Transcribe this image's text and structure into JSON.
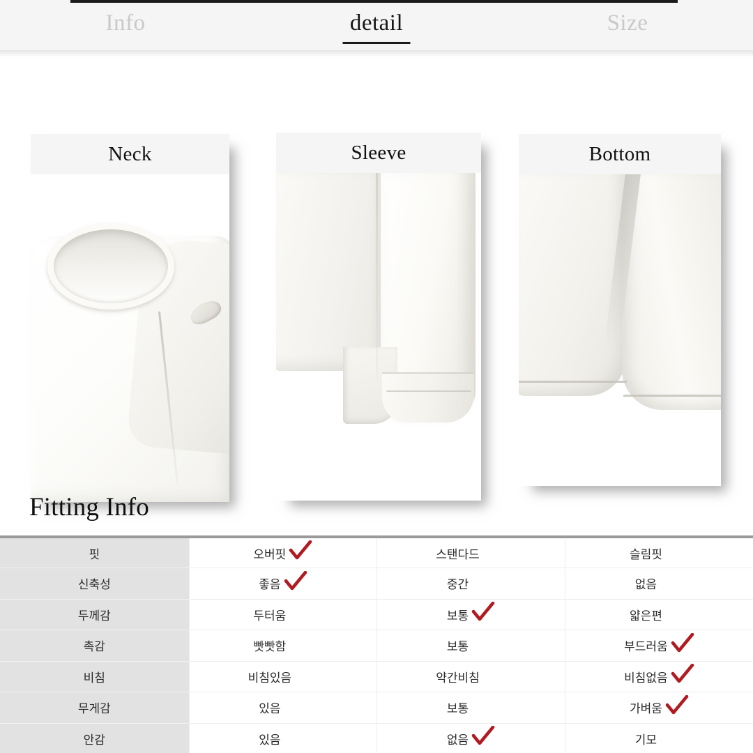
{
  "tabs": [
    {
      "label": "Info",
      "active": false
    },
    {
      "label": "detail",
      "active": true
    },
    {
      "label": "Size",
      "active": false
    }
  ],
  "detail_cards": [
    {
      "title": "Neck",
      "photo": "white-knit-top-crew-neck-closeup"
    },
    {
      "title": "Sleeve",
      "photo": "white-knit-long-sleeve-cuff-closeup"
    },
    {
      "title": "Bottom",
      "photo": "white-knit-hem-side-slit-closeup"
    }
  ],
  "fitting": {
    "heading": "Fitting Info",
    "check_color": "#b01b22",
    "rows": [
      {
        "label": "핏",
        "options": [
          {
            "text": "오버핏",
            "checked": true
          },
          {
            "text": "스탠다드",
            "checked": false
          },
          {
            "text": "슬림핏",
            "checked": false
          }
        ]
      },
      {
        "label": "신축성",
        "options": [
          {
            "text": "좋음",
            "checked": true
          },
          {
            "text": "중간",
            "checked": false
          },
          {
            "text": "없음",
            "checked": false
          }
        ]
      },
      {
        "label": "두께감",
        "options": [
          {
            "text": "두터움",
            "checked": false
          },
          {
            "text": "보통",
            "checked": true
          },
          {
            "text": "얇은편",
            "checked": false
          }
        ]
      },
      {
        "label": "촉감",
        "options": [
          {
            "text": "빳빳함",
            "checked": false
          },
          {
            "text": "보통",
            "checked": false
          },
          {
            "text": "부드러움",
            "checked": true
          }
        ]
      },
      {
        "label": "비침",
        "options": [
          {
            "text": "비침있음",
            "checked": false
          },
          {
            "text": "약간비침",
            "checked": false
          },
          {
            "text": "비침없음",
            "checked": true
          }
        ]
      },
      {
        "label": "무게감",
        "options": [
          {
            "text": "있음",
            "checked": false
          },
          {
            "text": "보통",
            "checked": false
          },
          {
            "text": "가벼움",
            "checked": true
          }
        ]
      },
      {
        "label": "안감",
        "options": [
          {
            "text": "있음",
            "checked": false
          },
          {
            "text": "없음",
            "checked": true
          },
          {
            "text": "기모",
            "checked": false
          }
        ]
      }
    ]
  }
}
